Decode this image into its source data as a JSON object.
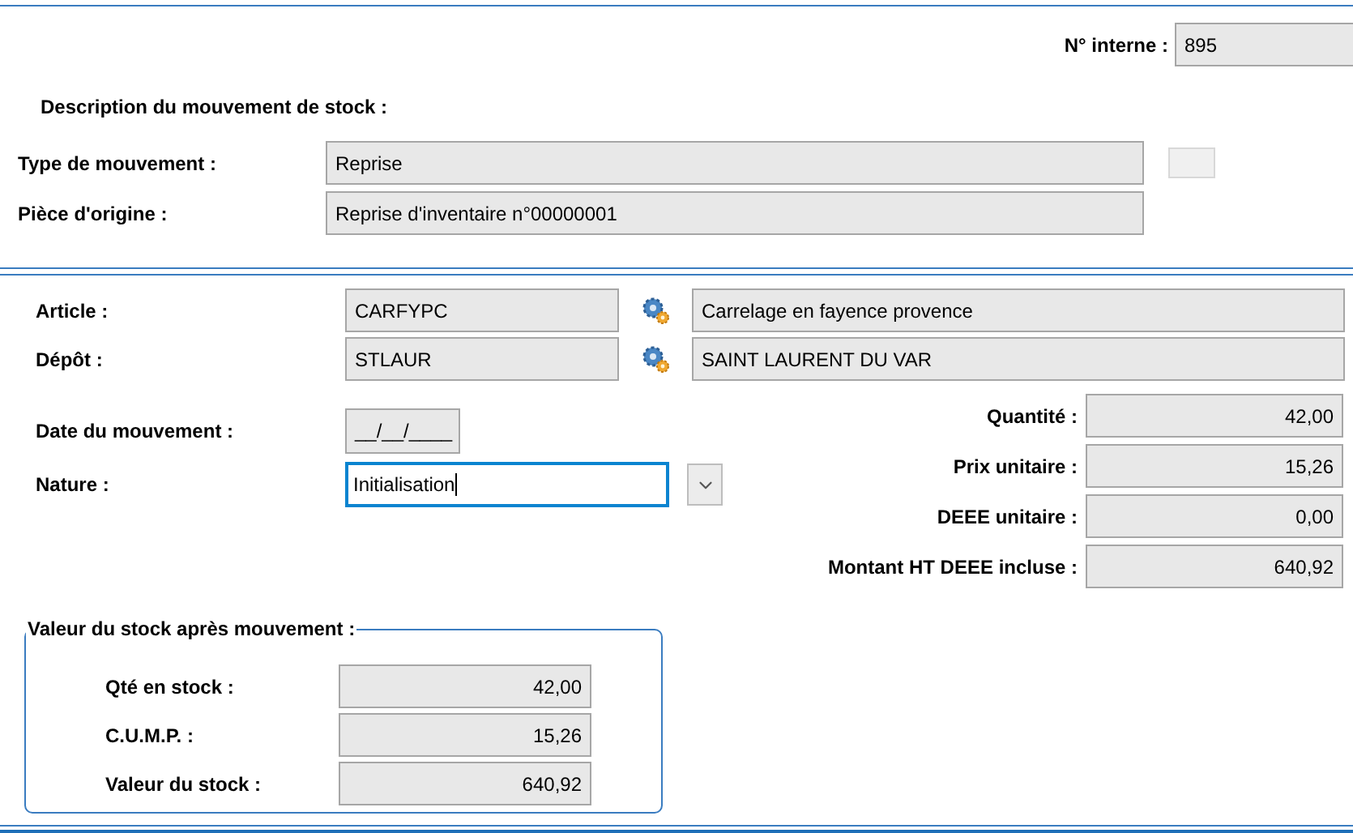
{
  "internal_number": {
    "label": "N° interne :",
    "value": "895"
  },
  "description": {
    "heading": "Description du mouvement de stock :",
    "fields": [
      {
        "label": "Type de mouvement :",
        "value": "Reprise"
      },
      {
        "label": "Pièce d'origine :",
        "value": "Reprise d'inventaire n°00000001"
      }
    ]
  },
  "lookups": [
    {
      "label": "Article :",
      "code": "CARFYPC",
      "name": "Carrelage en fayence provence"
    },
    {
      "label": "Dépôt :",
      "code": "STLAUR",
      "name": "SAINT LAURENT DU VAR"
    }
  ],
  "date": {
    "label": "Date du mouvement :",
    "value": "__/__/____"
  },
  "nature": {
    "label": "Nature :",
    "value": "Initialisation",
    "focused": true
  },
  "amounts": [
    {
      "label": "Quantité :",
      "value": "42,00"
    },
    {
      "label": "Prix unitaire :",
      "value": "15,26"
    },
    {
      "label": "DEEE unitaire :",
      "value": "0,00"
    },
    {
      "label": "Montant HT DEEE incluse :",
      "value": "640,92"
    }
  ],
  "stock": {
    "legend": "Valeur du stock après mouvement :",
    "rows": [
      {
        "label": "Qté en stock :",
        "value": "42,00"
      },
      {
        "label": "C.U.M.P. :",
        "value": "15,26"
      },
      {
        "label": "Valeur du stock :",
        "value": "640,92"
      }
    ]
  }
}
